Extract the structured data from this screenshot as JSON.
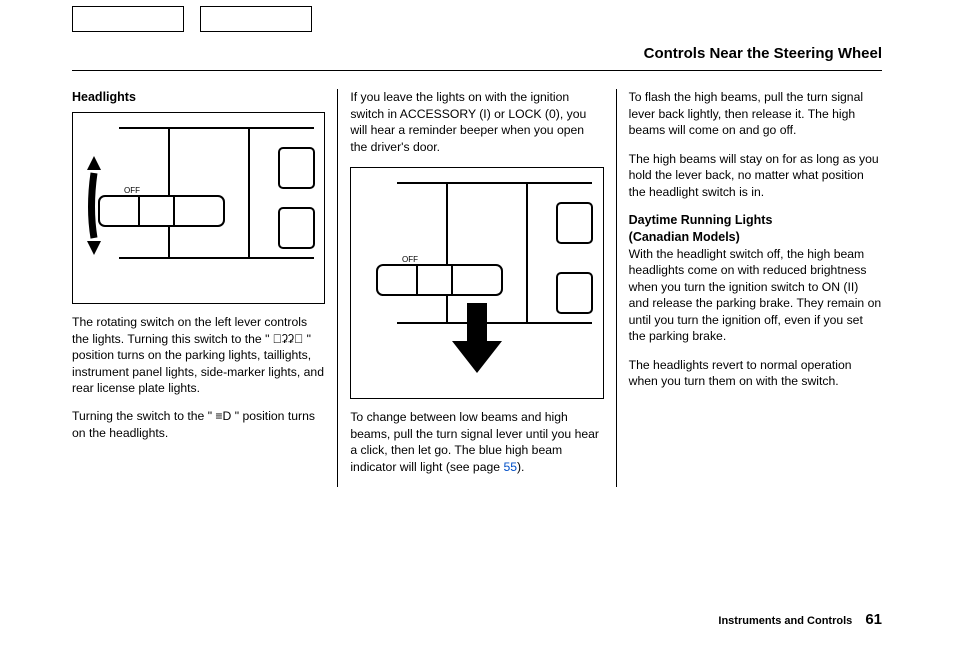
{
  "title": "Controls Near the Steering Wheel",
  "col1": {
    "heading": "Headlights",
    "p1a": "The rotating switch on the left lever controls the lights. Turning this switch to the \"",
    "p1b": "\" position turns on the parking lights, taillights, instrument panel lights, side-marker lights, and rear license plate lights.",
    "p2a": "Turning the switch to the \"",
    "p2b": "\" position turns on the headlights."
  },
  "col2": {
    "p1": "If you leave the lights on with the ignition switch in ACCESSORY (I) or LOCK (0), you will hear a reminder beeper when you open the driver's door.",
    "p2a": "To change between low beams and high beams, pull the turn signal lever until you hear a click, then let go. The blue high beam indicator will light (see page ",
    "link": "55",
    "p2b": ")."
  },
  "col3": {
    "p1": "To flash the high beams, pull the turn signal lever back lightly, then release it. The high beams will come on and go off.",
    "p2": "The high beams will stay on for as long as you hold the lever back, no matter what position the headlight switch is in.",
    "h2a": "Daytime Running Lights",
    "h2b": "(Canadian Models)",
    "p3": "With the headlight switch off, the high beam headlights come on with reduced brightness when you turn the ignition switch to ON (II) and release the parking brake. They remain on until you turn the ignition off, even if you set the parking brake.",
    "p4": "The headlights revert to normal operation when you turn them on with the switch."
  },
  "footer": {
    "section": "Instruments and Controls",
    "page": "61"
  }
}
